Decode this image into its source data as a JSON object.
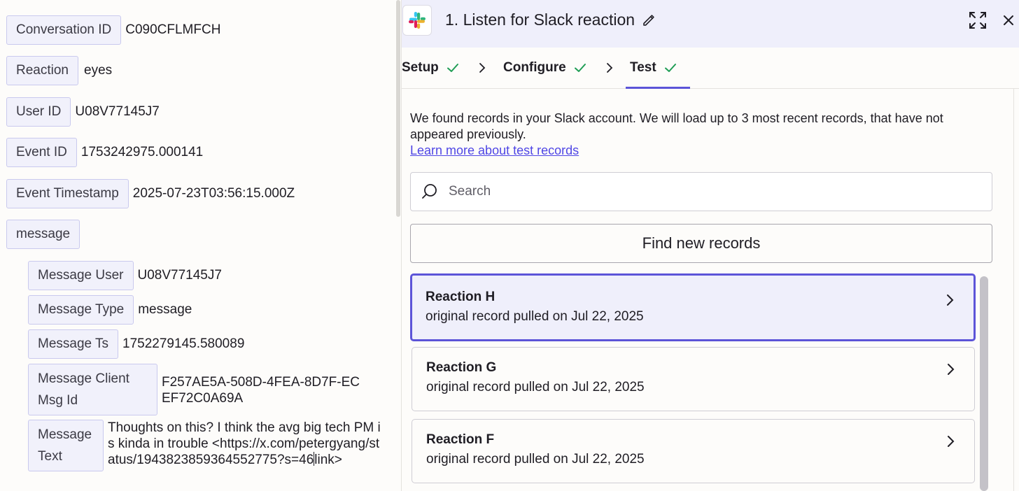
{
  "left": {
    "fields": [
      {
        "label": "Conversation ID",
        "value": "C090CFLMFCH"
      },
      {
        "label": "Reaction",
        "value": "eyes"
      },
      {
        "label": "User ID",
        "value": "U08V77145J7"
      },
      {
        "label": "Event ID",
        "value": "1753242975.000141"
      },
      {
        "label": "Event Timestamp",
        "value": "2025-07-23T03:56:15.000Z"
      },
      {
        "label": "message"
      }
    ],
    "message_fields": [
      {
        "label": "Message User",
        "value": "U08V77145J7"
      },
      {
        "label": "Message Type",
        "value": "message"
      },
      {
        "label": "Message Ts",
        "value": "1752279145.580089"
      },
      {
        "label": "Message Client Msg Id",
        "value": "F257AE5A-508D-4FEA-8D7F-ECEF72C0A69A"
      },
      {
        "label": "Message Text",
        "value_part1": "Thoughts on this? I think the avg big tech PM is kinda in trouble <https://x.com/petergyang/status/1943823859364552775?s=46",
        "value_part2": "link>"
      }
    ]
  },
  "header": {
    "title": "1. Listen for Slack reaction",
    "icons": {
      "app": "slack-logo",
      "edit": "pencil-icon",
      "expand": "expand-icon",
      "close": "close-icon"
    }
  },
  "steps": [
    {
      "label": "Setup",
      "complete": true
    },
    {
      "label": "Configure",
      "complete": true
    },
    {
      "label": "Test",
      "complete": true,
      "active": true
    }
  ],
  "test": {
    "intro": "We found records in your Slack account. We will load up to 3 most recent records, that have not appeared previously.",
    "learn_more": "Learn more about test records",
    "search_placeholder": "Search",
    "find_button": "Find new records",
    "records": [
      {
        "title": "Reaction H",
        "subtitle": "original record pulled on Jul 22, 2025",
        "selected": true
      },
      {
        "title": "Reaction G",
        "subtitle": "original record pulled on Jul 22, 2025",
        "selected": false
      },
      {
        "title": "Reaction F",
        "subtitle": "original record pulled on Jul 22, 2025",
        "selected": false
      }
    ]
  },
  "colors": {
    "accent": "#5c54d8",
    "link": "#4f46e5",
    "check": "#1f9d55",
    "header_bg": "#efeffb",
    "pill_bg": "#f1f1fb",
    "pill_border": "#c9c9ee"
  }
}
